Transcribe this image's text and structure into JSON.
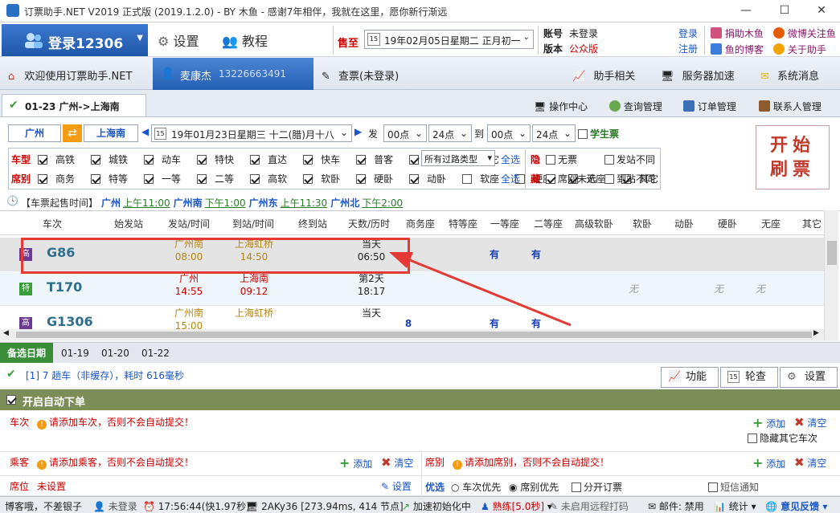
{
  "window": {
    "title": "订票助手.NET V2019 正式版 (2019.1.2.0) - BY 木鱼 - 感谢7年相伴，我就在这里，愿你新行渐远",
    "min": "—",
    "max": "☐",
    "close": "✕"
  },
  "topbar": {
    "login": "登录12306",
    "settings": "设置",
    "tutorial": "教程",
    "sale_label": "售至",
    "sale_date": "19年02月05日星期二 正月初一",
    "account_label": "账号",
    "account_value": "未登录",
    "login_link": "登录",
    "version_label": "版本",
    "version_value": "公众版",
    "register_link": "注册",
    "donate": "捐助木鱼",
    "weibo": "微博关注鱼",
    "blog": "鱼的博客",
    "about": "关于助手"
  },
  "tabs": {
    "welcome": "欢迎使用订票助手.NET",
    "user_name": "麦康杰",
    "user_phone": "13226663491",
    "query": "查票(未登录)",
    "helper": "助手相关",
    "accel": "服务器加速",
    "messages": "系统消息"
  },
  "subtabs": {
    "route": "01-23 广州->上海南",
    "ops": "操作中心",
    "query_mgmt": "查询管理",
    "order_mgmt": "订单管理",
    "contacts": "联系人管理"
  },
  "search": {
    "from": "广州",
    "to": "上海南",
    "date": "19年01月23日星期三 十二(腊)月十八",
    "depart_label": "发",
    "t1": "00点",
    "t2": "24点",
    "arrive_label": "到",
    "t3": "00点",
    "t4": "24点",
    "student": "学生票"
  },
  "filters": {
    "type_label": "车型",
    "types": [
      {
        "t": "高铁",
        "on": true
      },
      {
        "t": "城铁",
        "on": true
      },
      {
        "t": "动车",
        "on": true
      },
      {
        "t": "特快",
        "on": true
      },
      {
        "t": "直达",
        "on": true
      },
      {
        "t": "快车",
        "on": true
      },
      {
        "t": "普客",
        "on": true
      },
      {
        "t": "临客",
        "on": true
      },
      {
        "t": "其它",
        "on": true
      }
    ],
    "pass_type": "所有过路类型",
    "select_all": "全选",
    "seat_label": "席别",
    "seats": [
      {
        "t": "商务",
        "on": true
      },
      {
        "t": "特等",
        "on": true
      },
      {
        "t": "一等",
        "on": true
      },
      {
        "t": "二等",
        "on": true
      },
      {
        "t": "高软",
        "on": true
      },
      {
        "t": "软卧",
        "on": true
      },
      {
        "t": "硬卧",
        "on": true
      },
      {
        "t": "动卧",
        "on": true
      },
      {
        "t": "软座",
        "on": false
      },
      {
        "t": "硬座",
        "on": false
      },
      {
        "t": "无座",
        "on": true
      },
      {
        "t": "其它",
        "on": true
      }
    ],
    "hide_label": "隐",
    "no_ticket": "无票",
    "diff_depart": "发站不同",
    "hide2_label": "藏",
    "seat_unselected": "席别未选",
    "diff_arrive": "到站不同"
  },
  "start_button": {
    "line1": "开始",
    "line2": "刷票"
  },
  "sale_times": {
    "label": "【车票起售时间】",
    "items": [
      {
        "s": "广州",
        "t": "上午11:00"
      },
      {
        "s": "广州南",
        "t": "下午1:00"
      },
      {
        "s": "广州东",
        "t": "上午11:30"
      },
      {
        "s": "广州北",
        "t": "下午2:00"
      }
    ]
  },
  "grid": {
    "headers": [
      "车次",
      "始发站",
      "发站/时间",
      "到站/时间",
      "终到站",
      "天数/历时",
      "商务座",
      "特等座",
      "一等座",
      "二等座",
      "高级软卧",
      "软卧",
      "动卧",
      "硬卧",
      "无座",
      "其它"
    ],
    "rows": [
      {
        "type": "高",
        "no": "G86",
        "dep_st": "广州南",
        "dep_t": "08:00",
        "arr_st": "上海虹桥",
        "arr_t": "14:50",
        "day": "当天",
        "dur": "06:50",
        "first": "有",
        "second": "有"
      },
      {
        "type": "特",
        "no": "T170",
        "dep_st": "广州",
        "dep_t": "14:55",
        "arr_st": "上海南",
        "arr_t": "09:12",
        "day": "第2天",
        "dur": "18:17",
        "c1": "无",
        "c2": "无",
        "c3": "无"
      },
      {
        "type": "高",
        "no": "G1306",
        "dep_st": "广州南",
        "dep_t": "15:00",
        "arr_st": "上海虹桥",
        "arr_t": "",
        "day": "当天",
        "dur": "",
        "biz": "8",
        "first": "有",
        "second": "有"
      }
    ]
  },
  "dates_bar": {
    "label": "备选日期",
    "d1": "01-19",
    "d2": "01-20",
    "d3": "01-22"
  },
  "status": {
    "text": "[1] 7 趟车（非缓存），耗时 616毫秒",
    "btn_func": "功能",
    "btn_poll": "轮查",
    "btn_settings": "设置"
  },
  "auto": {
    "title": "开启自动下单",
    "train_label": "车次",
    "train_warn": "请添加车次，否则不会自动提交！",
    "add": "添加",
    "clear": "清空",
    "hide_other": "隐藏其它车次",
    "passenger_label": "乘客",
    "passenger_warn": "请添加乘客，否则不会自动提交！",
    "seat_label": "席别",
    "seat_warn": "请添加席别，否则不会自动提交！",
    "pos_label": "席位",
    "pos_value": "未设置",
    "pos_settings": "设置",
    "pref_label": "优选",
    "pref_train": "车次优先",
    "pref_seat": "席别优先",
    "split": "分开订票",
    "sms": "短信通知"
  },
  "statusbar": {
    "s1": "博客哦，不差银子",
    "s2": "未登录",
    "s3": "17:56:44(快1.97秒)",
    "s4": "2AKy36 [273.94ms, 414 节点]",
    "s5": "加速初始化中",
    "s6": "熟练[5.0秒]",
    "s7": "未启用远程打码",
    "s8": "邮件: 禁用",
    "s9": "统计",
    "s10": "意见反馈"
  },
  "colors": {
    "accent": "#2460b4",
    "red": "#e53935",
    "olive": "#7d8d57"
  }
}
